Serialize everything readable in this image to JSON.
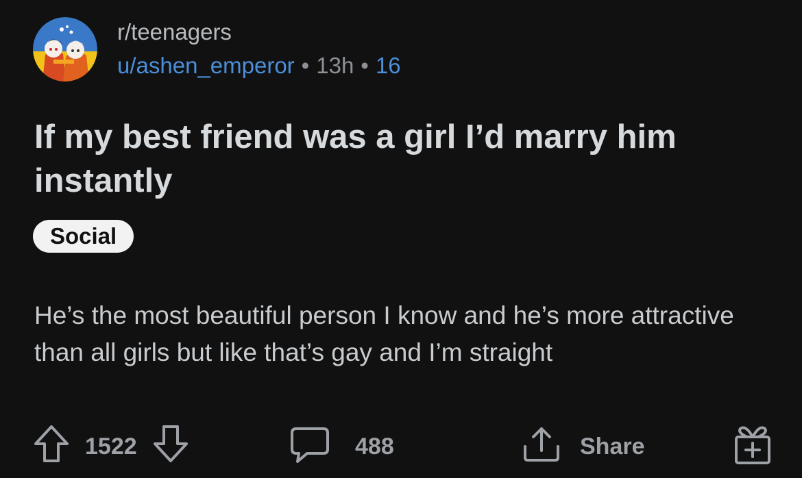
{
  "post": {
    "subreddit": "r/teenagers",
    "author": "u/ashen_emperor",
    "age": "13h",
    "score_label": "16",
    "separator": "•",
    "title": "If my best friend was a girl I’d marry him instantly",
    "flair": "Social",
    "body": "He’s the most beautiful person I know and he’s more attractive than all girls but like that’s gay and I’m straight"
  },
  "actions": {
    "upvotes": "1522",
    "comments": "488",
    "share_label": "Share"
  },
  "icons": {
    "upvote": "arrow-up-icon",
    "downvote": "arrow-down-icon",
    "comment": "speech-bubble-icon",
    "share": "share-icon",
    "award": "gift-icon"
  },
  "colors": {
    "background": "#111112",
    "link_blue": "#4b8fdb",
    "text": "#d7dadc",
    "muted": "#8d9196"
  }
}
